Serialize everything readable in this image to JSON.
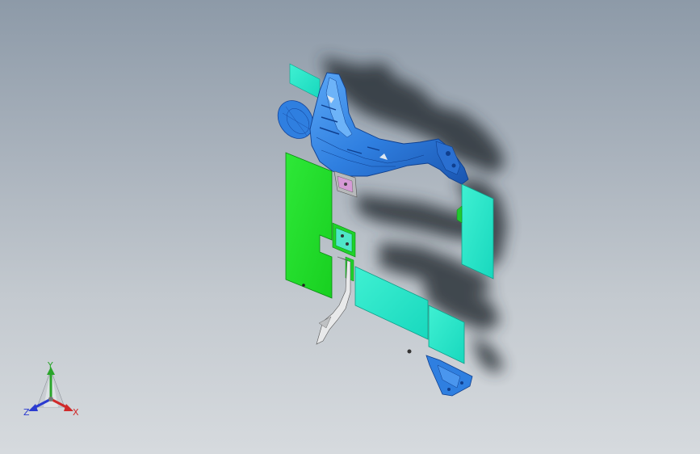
{
  "viewport": {
    "background_top": "#8d9aa8",
    "background_bottom": "#d6dade"
  },
  "model": {
    "colors": {
      "blue_part": "#2f7fe0",
      "blue_dark": "#1a55b0",
      "green_panel": "#22e02a",
      "cyan_panel": "#22e8c8",
      "shadow": "#3a3f45",
      "gray_part": "#d8dadc"
    }
  },
  "triad": {
    "x_label": "X",
    "y_label": "Y",
    "z_label": "Z",
    "x_color": "#d02a2a",
    "y_color": "#2aa52a",
    "z_color": "#2a3ad0"
  }
}
